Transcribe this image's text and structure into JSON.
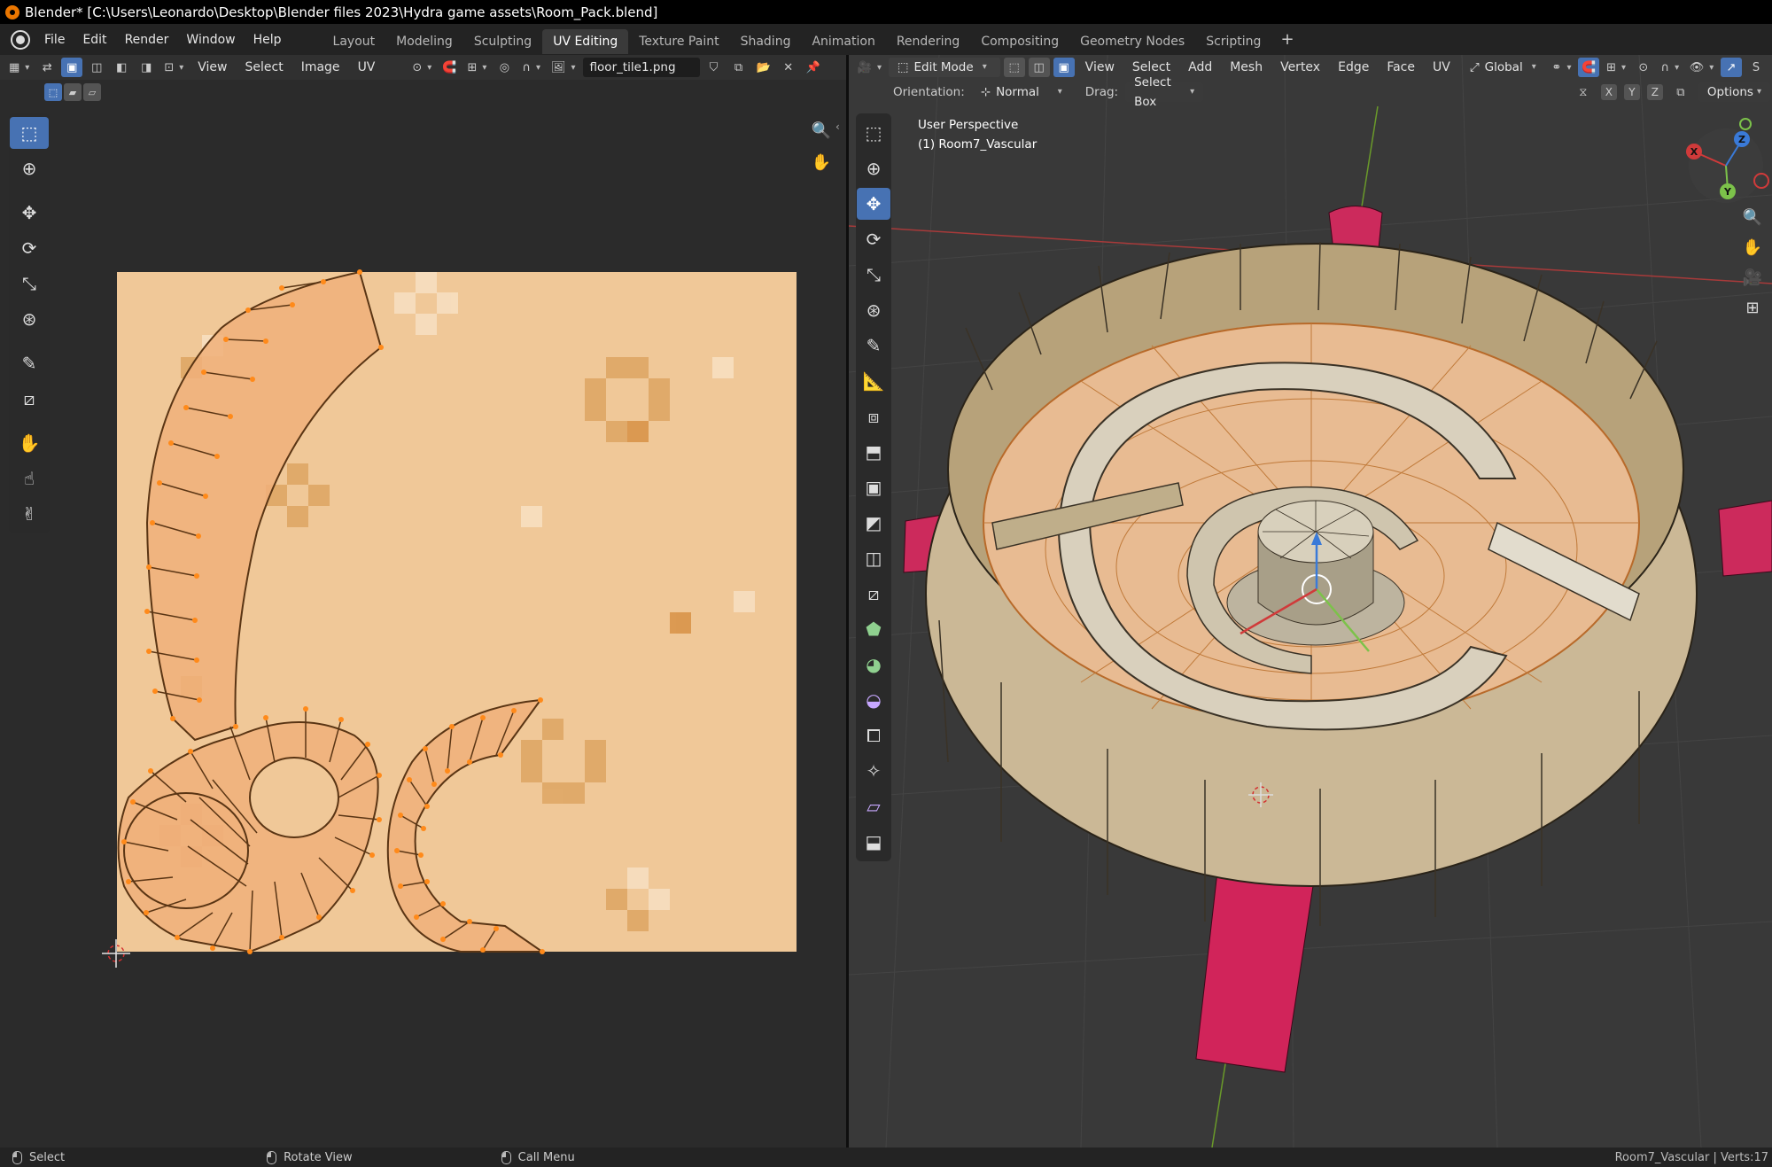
{
  "titlebar": {
    "text": "Blender* [C:\\Users\\Leonardo\\Desktop\\Blender files 2023\\Hydra game assets\\Room_Pack.blend]"
  },
  "menu": {
    "file": "File",
    "edit": "Edit",
    "render": "Render",
    "window": "Window",
    "help": "Help"
  },
  "workspace_tabs": [
    {
      "label": "Layout"
    },
    {
      "label": "Modeling"
    },
    {
      "label": "Sculpting"
    },
    {
      "label": "UV Editing",
      "active": true
    },
    {
      "label": "Texture Paint"
    },
    {
      "label": "Shading"
    },
    {
      "label": "Animation"
    },
    {
      "label": "Rendering"
    },
    {
      "label": "Compositing"
    },
    {
      "label": "Geometry Nodes"
    },
    {
      "label": "Scripting"
    }
  ],
  "uv_editor": {
    "menus": {
      "view": "View",
      "select": "Select",
      "image": "Image",
      "uv": "UV"
    },
    "image_name": "floor_tile1.png",
    "tools": [
      "select-box",
      "cursor",
      "move",
      "rotate",
      "scale",
      "transform",
      "annotate",
      "rip",
      "grab",
      "relax",
      "pinch"
    ]
  },
  "viewport": {
    "mode": "Edit Mode",
    "menus": {
      "view": "View",
      "select": "Select",
      "add": "Add",
      "mesh": "Mesh",
      "vertex": "Vertex",
      "edge": "Edge",
      "face": "Face",
      "uv": "UV"
    },
    "transform_orientation": "Global",
    "orientation_label": "Orientation:",
    "orientation_value": "Normal",
    "drag_label": "Drag:",
    "drag_value": "Select Box",
    "axis_x": "X",
    "axis_y": "Y",
    "axis_z": "Z",
    "options": "Options",
    "overlay_perspective": "User Perspective",
    "overlay_object": "(1) Room7_Vascular",
    "gizmo": {
      "x": "X",
      "y": "Y",
      "z": "Z"
    }
  },
  "statusbar": {
    "select": "Select",
    "rotate_view": "Rotate View",
    "call_menu": "Call Menu",
    "right_info": "Room7_Vascular | Verts:17"
  },
  "colors": {
    "accent": "#4772b3",
    "uv_select": "#ff8a1a",
    "texture": "#f0c898",
    "red_mesh": "#d1245a"
  }
}
